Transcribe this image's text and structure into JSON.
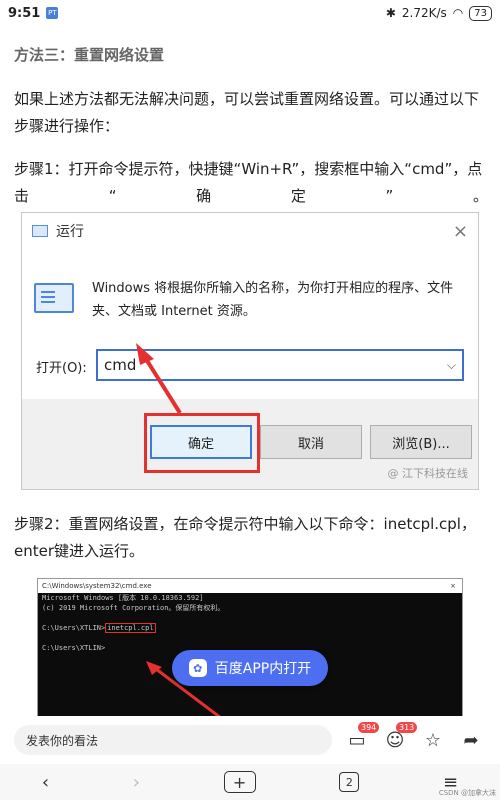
{
  "status_bar": {
    "time": "9:51",
    "app_badge": "PT",
    "network_speed": "2.72K/s",
    "battery": "73"
  },
  "article": {
    "section_title": "方法三：重置网络设置",
    "para1": "如果上述方法都无法解决问题，可以尝试重置网络设置。可以通过以下步骤进行操作：",
    "step1_line1": "步骤1：打开命令提示符，快捷键“Win+R”，搜索框中输入“cmd”，点",
    "step1_line2": [
      "击",
      "“",
      "确",
      "定",
      "”",
      "。"
    ],
    "step2": "步骤2：重置网络设置，在命令提示符中输入以下命令：inetcpl.cpl，enter键进入运行。"
  },
  "run_dialog": {
    "title": "运行",
    "close": "×",
    "description": "Windows 将根据你所输入的名称，为你打开相应的程序、文件夹、文档或 Internet 资源。",
    "open_label": "打开(O):",
    "input_value": "cmd",
    "ok_label": "确定",
    "cancel_label": "取消",
    "browse_label": "浏览(B)...",
    "watermark": "@ 江下科技在线"
  },
  "cmd_window": {
    "title": "C:\\Windows\\system32\\cmd.exe",
    "close": "×",
    "line1": "Microsoft Windows [版本 10.0.18363.592]",
    "line2": "(c) 2019 Microsoft Corporation。保留所有权利。",
    "prompt1": "C:\\Users\\XTLIN>",
    "command": "inetcpl.cpl",
    "prompt2": "C:\\Users\\XTLIN>"
  },
  "open_app": {
    "label": "百度APP内打开",
    "icon": "paw-icon"
  },
  "comment_bar": {
    "placeholder": "发表你的看法",
    "comments_count": "394",
    "likes_count": "313"
  },
  "nav": {
    "tabs_count": "2"
  },
  "footer_mark": "CSDN @加拿大沫"
}
